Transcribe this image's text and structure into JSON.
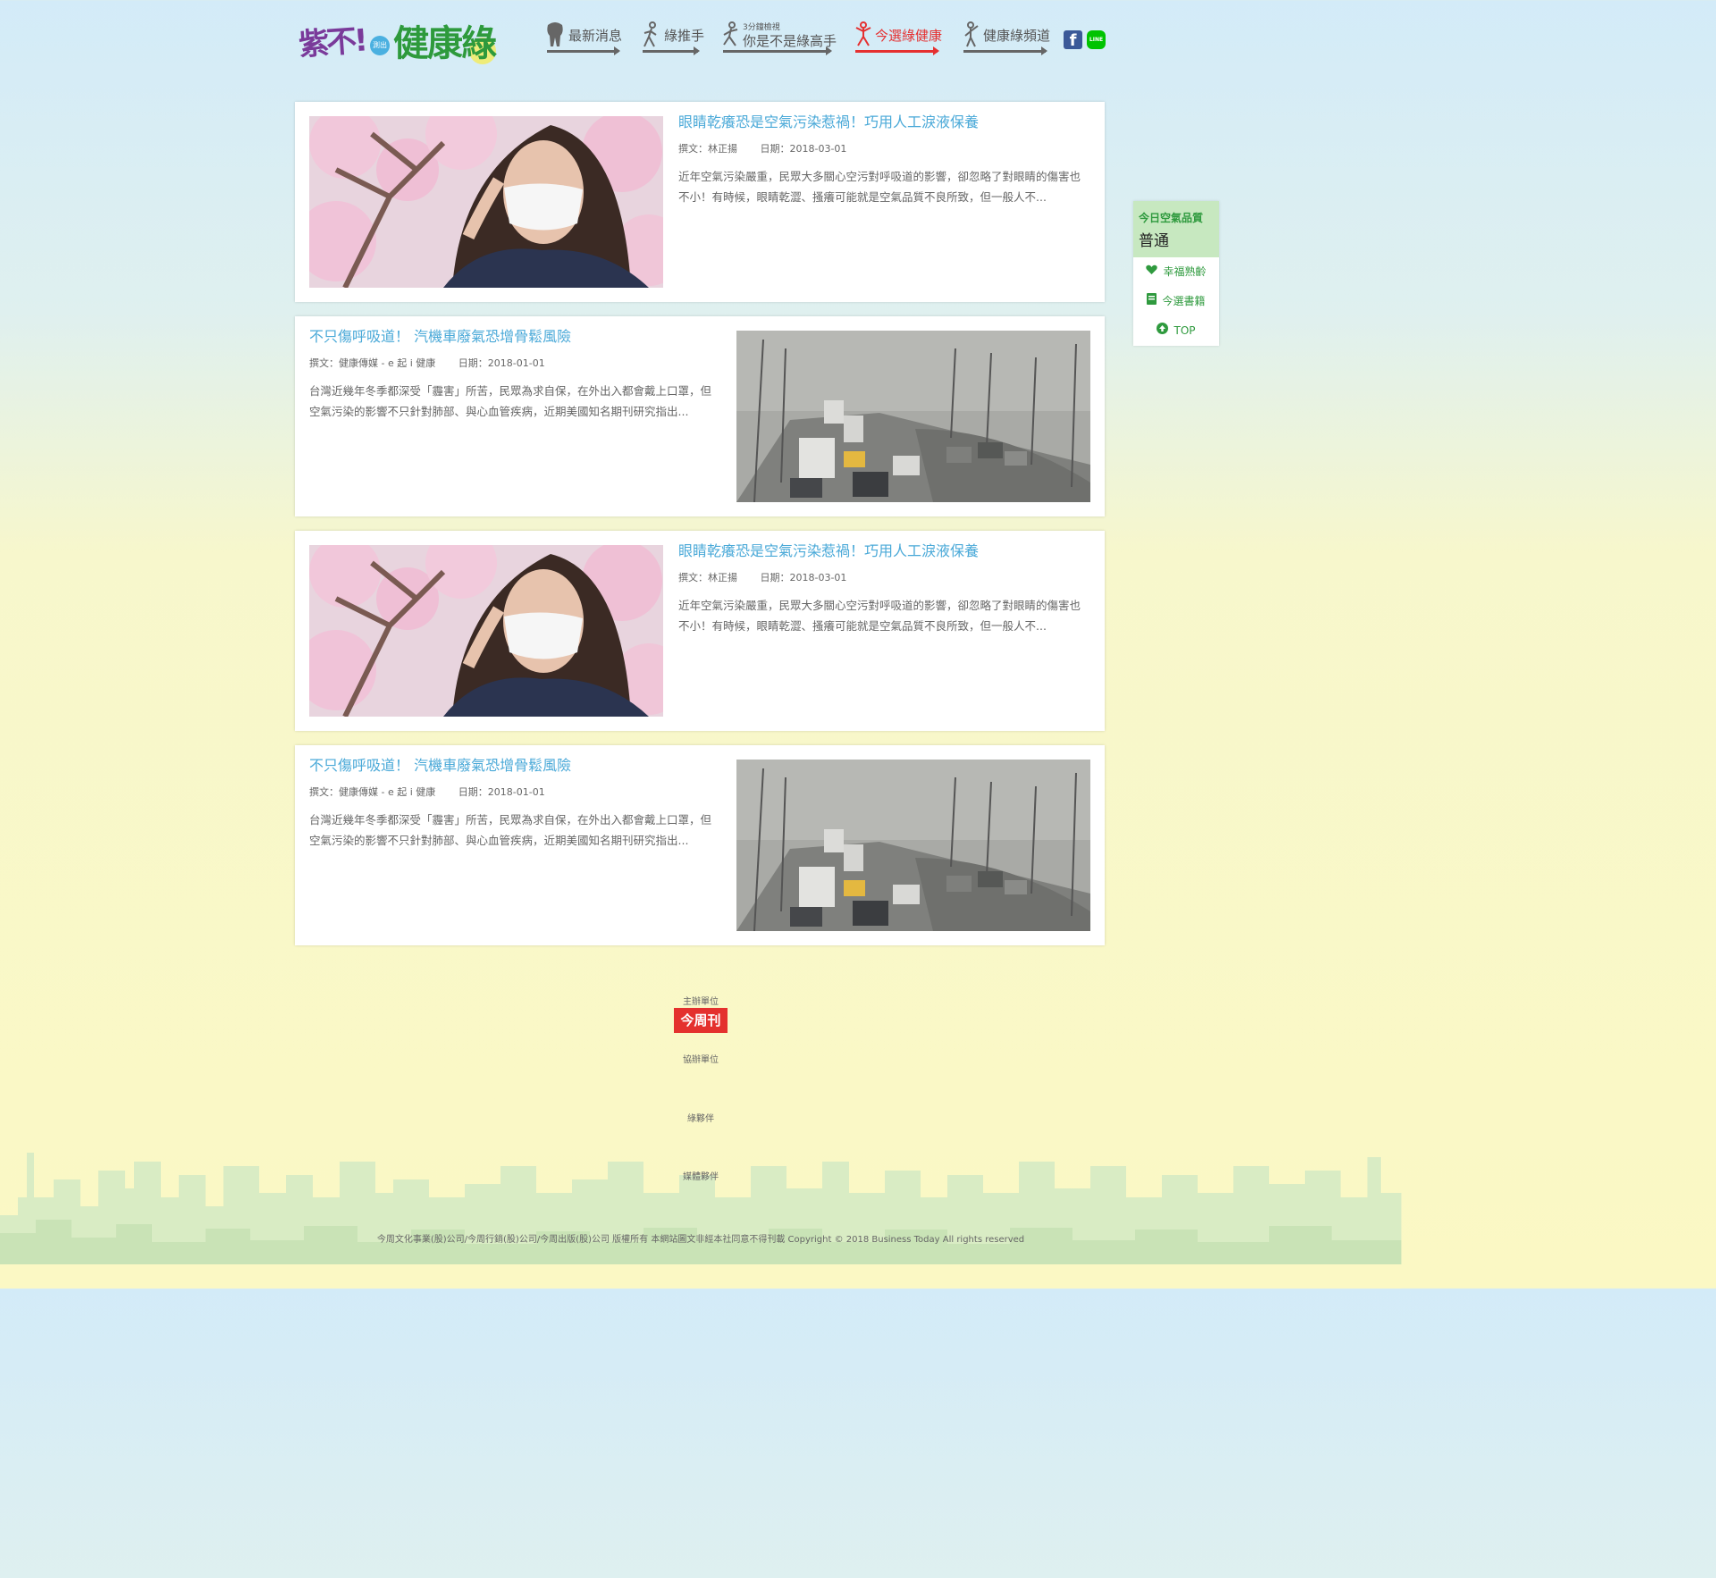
{
  "header": {
    "logo": {
      "part1": "紫不!",
      "part2": "測出",
      "part3": "健康綠"
    },
    "nav": [
      {
        "label": "最新消息",
        "sub": ""
      },
      {
        "label": "綠推手",
        "sub": ""
      },
      {
        "label": "你是不是綠高手",
        "sub": "3分鐘檢視"
      },
      {
        "label": "今選綠健康",
        "sub": ""
      },
      {
        "label": "健康綠頻道",
        "sub": ""
      }
    ],
    "social": {
      "facebook": "f",
      "line": "LINE"
    }
  },
  "articles": [
    {
      "title": "眼睛乾癢恐是空氣污染惹禍！巧用人工淚液保養",
      "author": "撰文：林正揚",
      "date": "日期：2018-03-01",
      "excerpt": "近年空氣污染嚴重，民眾大多關心空污對呼吸道的影響，卻忽略了對眼睛的傷害也不小！有時候，眼睛乾澀、搔癢可能就是空氣品質不良所致，但一般人不..."
    },
    {
      "title": "不只傷呼吸道！ 汽機車廢氣恐增骨鬆風險",
      "author": "撰文：健康傳媒 - e 起 i 健康",
      "date": "日期：2018-01-01",
      "excerpt": "台灣近幾年冬季都深受「霾害」所苦，民眾為求自保，在外出入都會戴上口罩，但空氣污染的影響不只針對肺部、與心血管疾病，近期美國知名期刊研究指出..."
    },
    {
      "title": "眼睛乾癢恐是空氣污染惹禍！巧用人工淚液保養",
      "author": "撰文：林正揚",
      "date": "日期：2018-03-01",
      "excerpt": "近年空氣污染嚴重，民眾大多關心空污對呼吸道的影響，卻忽略了對眼睛的傷害也不小！有時候，眼睛乾澀、搔癢可能就是空氣品質不良所致，但一般人不..."
    },
    {
      "title": "不只傷呼吸道！ 汽機車廢氣恐增骨鬆風險",
      "author": "撰文：健康傳媒 - e 起 i 健康",
      "date": "日期：2018-01-01",
      "excerpt": "台灣近幾年冬季都深受「霾害」所苦，民眾為求自保，在外出入都會戴上口罩，但空氣污染的影響不只針對肺部、與心血管疾病，近期美國知名期刊研究指出..."
    }
  ],
  "sidebar": {
    "air_quality_title": "今日空氣品質",
    "air_quality_value": "普通",
    "links": [
      {
        "label": "幸福熟齡",
        "icon": "heart-icon"
      },
      {
        "label": "今選書籍",
        "icon": "book-icon"
      },
      {
        "label": "TOP",
        "icon": "arrow-up-circle-icon"
      }
    ]
  },
  "footer": {
    "organizer": "主辦單位",
    "organizer_logo": "今周刊",
    "co_organizer": "協辦單位",
    "green_partner": "綠夥伴",
    "media_partner": "媒體夥伴",
    "copyright": "今周文化事業(股)公司/今周行銷(股)公司/今周出版(股)公司 版權所有 本網站圖文非經本社同意不得刊載 Copyright © 2018 Business Today All rights reserved"
  },
  "colors": {
    "accent_blue": "#4aa9d8",
    "active_red": "#e53030",
    "green": "#2f9a3e"
  }
}
